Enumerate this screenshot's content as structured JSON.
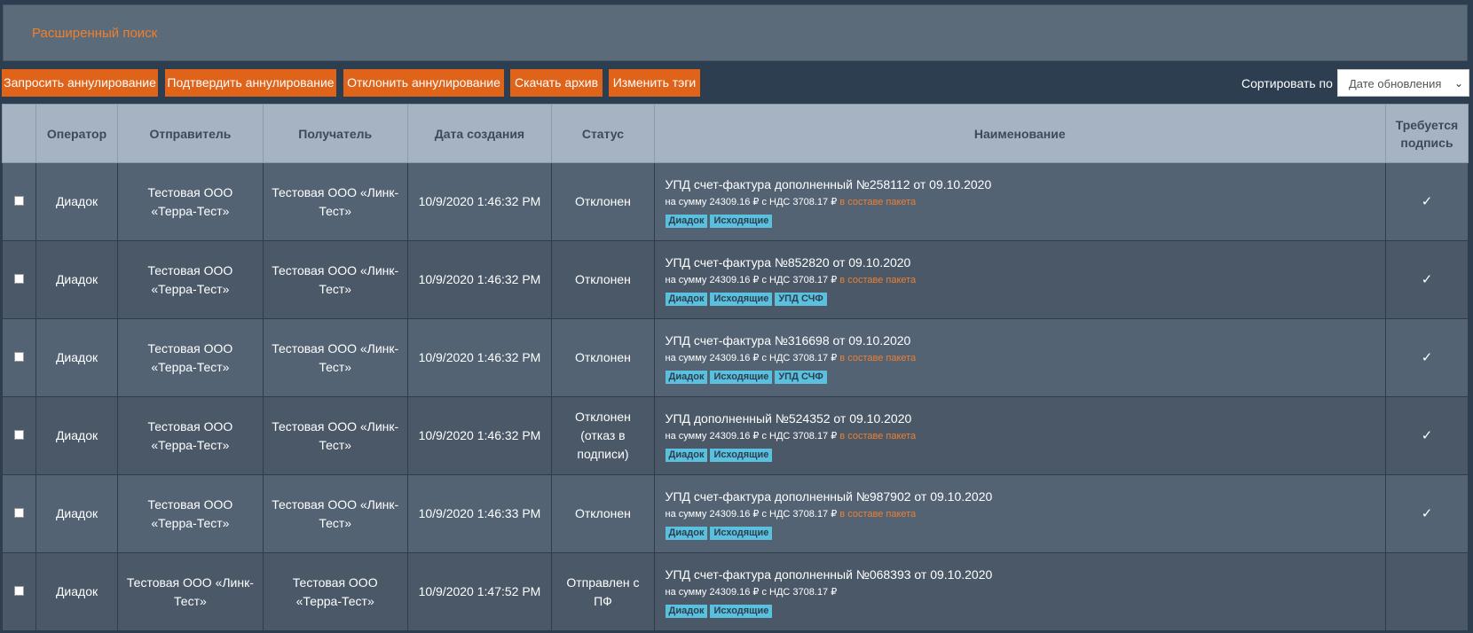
{
  "search": {
    "title": "Расширенный поиск"
  },
  "toolbar": {
    "buttons": [
      "Запросить аннулирование",
      "Подтвердить аннулирование",
      "Отклонить аннулирование",
      "Скачать архив",
      "Изменить тэги"
    ],
    "sort_label": "Сортировать по",
    "sort_value": "Дате обновления"
  },
  "table": {
    "headers": {
      "operator": "Оператор",
      "sender": "Отправитель",
      "recipient": "Получатель",
      "created": "Дата создания",
      "status": "Статус",
      "name": "Наименование",
      "sign_l1": "Требуется",
      "sign_l2": "подпись"
    },
    "rows": [
      {
        "operator": "Диадок",
        "sender": "Тестовая ООО «Терра-Тест»",
        "recipient": "Тестовая ООО «Линк-Тест»",
        "created": "10/9/2020 1:46:32 PM",
        "status": "Отклонен",
        "title": "УПД счет-фактура дополненный №258112 от 09.10.2020",
        "sum": "на сумму 24309.16 ₽ с НДС 3708.17 ₽",
        "package": "в составе пакета",
        "tags": [
          "Диадок",
          "Исходящие"
        ],
        "sign": "✓"
      },
      {
        "operator": "Диадок",
        "sender": "Тестовая ООО «Терра-Тест»",
        "recipient": "Тестовая ООО «Линк-Тест»",
        "created": "10/9/2020 1:46:32 PM",
        "status": "Отклонен",
        "title": "УПД счет-фактура №852820 от 09.10.2020",
        "sum": "на сумму 24309.16 ₽ с НДС 3708.17 ₽",
        "package": "в составе пакета",
        "tags": [
          "Диадок",
          "Исходящие",
          "УПД СЧФ"
        ],
        "sign": "✓"
      },
      {
        "operator": "Диадок",
        "sender": "Тестовая ООО «Терра-Тест»",
        "recipient": "Тестовая ООО «Линк-Тест»",
        "created": "10/9/2020 1:46:32 PM",
        "status": "Отклонен",
        "title": "УПД счет-фактура №316698 от 09.10.2020",
        "sum": "на сумму 24309.16 ₽ с НДС 3708.17 ₽",
        "package": "в составе пакета",
        "tags": [
          "Диадок",
          "Исходящие",
          "УПД СЧФ"
        ],
        "sign": "✓"
      },
      {
        "operator": "Диадок",
        "sender": "Тестовая ООО «Терра-Тест»",
        "recipient": "Тестовая ООО «Линк-Тест»",
        "created": "10/9/2020 1:46:32 PM",
        "status": "Отклонен (отказ в подписи)",
        "title": "УПД дополненный №524352 от 09.10.2020",
        "sum": "на сумму 24309.16 ₽ с НДС 3708.17 ₽",
        "package": "в составе пакета",
        "tags": [
          "Диадок",
          "Исходящие"
        ],
        "sign": "✓"
      },
      {
        "operator": "Диадок",
        "sender": "Тестовая ООО «Терра-Тест»",
        "recipient": "Тестовая ООО «Линк-Тест»",
        "created": "10/9/2020 1:46:33 PM",
        "status": "Отклонен",
        "title": "УПД счет-фактура дополненный №987902 от 09.10.2020",
        "sum": "на сумму 24309.16 ₽ с НДС 3708.17 ₽",
        "package": "в составе пакета",
        "tags": [
          "Диадок",
          "Исходящие"
        ],
        "sign": "✓"
      },
      {
        "operator": "Диадок",
        "sender": "Тестовая ООО «Линк-Тест»",
        "recipient": "Тестовая ООО «Терра-Тест»",
        "created": "10/9/2020 1:47:52 PM",
        "status": "Отправлен с ПФ",
        "title": "УПД счет-фактура дополненный №068393 от 09.10.2020",
        "sum": "на сумму 24309.16 ₽ с НДС 3708.17 ₽",
        "package": "",
        "tags": [
          "Диадок",
          "Исходящие"
        ],
        "sign": ""
      }
    ]
  }
}
